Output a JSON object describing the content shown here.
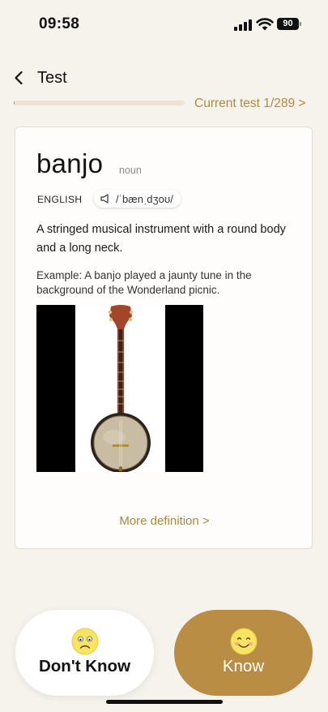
{
  "status_bar": {
    "time": "09:58",
    "battery_level": "90",
    "icons": [
      "signal-icon",
      "wifi-icon",
      "battery-icon"
    ]
  },
  "header": {
    "back_icon": "chevron-left-icon",
    "title": "Test"
  },
  "progress": {
    "current": 1,
    "total": 289,
    "label": "Current test 1/289 >"
  },
  "card": {
    "word": "banjo",
    "part_of_speech": "noun",
    "language": "ENGLISH",
    "pronunciation_icon": "speaker-icon",
    "pronunciation": "/ˈbænˌdʒoʊ/",
    "definition": "A stringed musical instrument with a round body and a long neck.",
    "example": "Example: A banjo played a jaunty tune in the background of the Wonderland picnic.",
    "image_subject": "banjo",
    "more_definition": "More definition >"
  },
  "buttons": {
    "dont_know": {
      "label": "Don't Know",
      "icon": "sad-face-icon"
    },
    "know": {
      "label": "Know",
      "icon": "smiley-face-icon"
    }
  },
  "colors": {
    "background": "#f6f2ec",
    "accent": "#b98d43",
    "accent_text": "#b08a3e",
    "card": "#fffdfb"
  }
}
